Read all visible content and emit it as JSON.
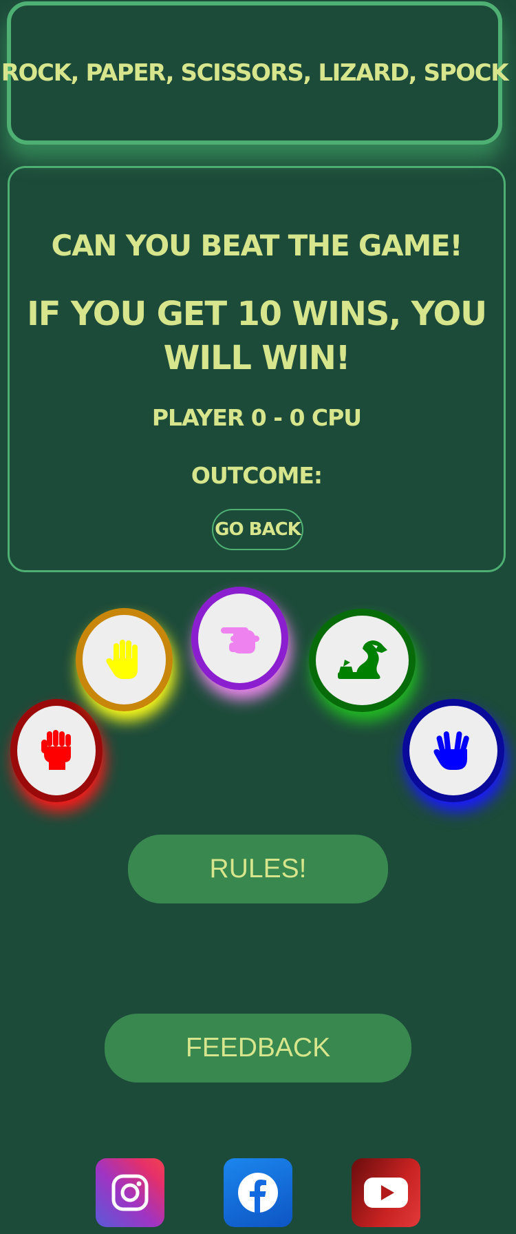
{
  "header": {
    "title": "ROCK, PAPER, SCISSORS, LIZARD, SPOCK"
  },
  "panel": {
    "challenge": "CAN YOU BEAT THE GAME!",
    "goal": "IF YOU GET 10 WINS, YOU WILL WIN!",
    "score": "PLAYER 0 - 0 CPU",
    "outcome_label": "OUTCOME:",
    "go_back_label": "GO BACK"
  },
  "scoreboard": {
    "player": 0,
    "cpu": 0,
    "wins_needed": 10
  },
  "choices": [
    {
      "name": "rock",
      "icon": "hand-fist-icon",
      "ring_color": "#9a0a0a",
      "glow_color": "#ff1a1a",
      "icon_color": "#ff0000"
    },
    {
      "name": "paper",
      "icon": "hand-open-icon",
      "ring_color": "#c8860a",
      "glow_color": "#ffff1a",
      "icon_color": "#ffff00"
    },
    {
      "name": "scissors",
      "icon": "hand-scissors-icon",
      "ring_color": "#8b1ecf",
      "glow_color": "#ee88ee",
      "icon_color": "#ee82ee"
    },
    {
      "name": "lizard",
      "icon": "dragon-icon",
      "ring_color": "#086b0a",
      "glow_color": "#22bb22",
      "icon_color": "#008000"
    },
    {
      "name": "spock",
      "icon": "hand-spock-icon",
      "ring_color": "#0a0a9a",
      "glow_color": "#1a1aff",
      "icon_color": "#0000ff"
    }
  ],
  "buttons": {
    "rules_label": "RULES!",
    "feedback_label": "FEEDBACK"
  },
  "social": [
    {
      "name": "instagram",
      "icon": "instagram-icon"
    },
    {
      "name": "facebook",
      "icon": "facebook-icon"
    },
    {
      "name": "youtube",
      "icon": "youtube-icon"
    }
  ],
  "colors": {
    "background": "#1d4b3a",
    "accent_border": "#4eb072",
    "text": "#d7e68c",
    "button_fill": "#38884f"
  }
}
